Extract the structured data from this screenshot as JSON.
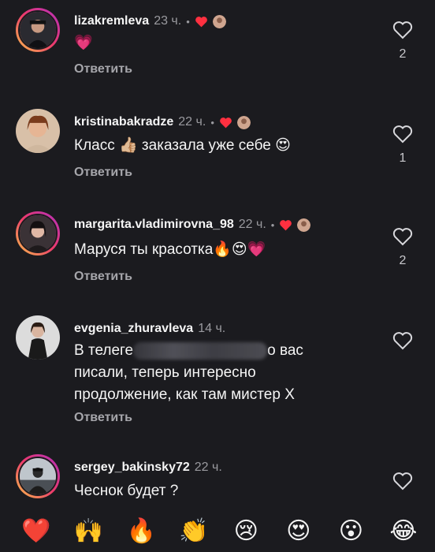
{
  "reply_label": "Ответить",
  "accent_color": "#ff3040",
  "comments": [
    {
      "username": "lizakremleva",
      "time": "23 ч.",
      "text": "💗",
      "likes": "2",
      "has_creator_like": true
    },
    {
      "username": "kristinabakradze",
      "time": "22 ч.",
      "text": "Класс 👍🏼 заказала уже себе 😍",
      "likes": "1",
      "has_creator_like": true
    },
    {
      "username": "margarita.vladimirovna_98",
      "time": "22 ч.",
      "text": "Маруся ты красотка🔥😍💗",
      "likes": "2",
      "has_creator_like": true
    },
    {
      "username": "evgenia_zhuravleva",
      "time": "14 ч.",
      "text_line1_start": "В телеге",
      "text_line1_end": "о вас",
      "text_line2": "писали, теперь интересно",
      "text_line3": "продолжение, как там мистер Х",
      "likes": "",
      "has_creator_like": false
    },
    {
      "username": "sergey_bakinsky72",
      "time": "22 ч.",
      "text": "Чеснок будет ?",
      "likes": "",
      "has_creator_like": false
    }
  ],
  "reactions": [
    "❤️",
    "🙌",
    "🔥",
    "👏",
    "😢",
    "😍",
    "😮",
    "😂"
  ],
  "icons": {
    "like": "heart-outline-icon",
    "creator_like": "red-heart-icon"
  }
}
